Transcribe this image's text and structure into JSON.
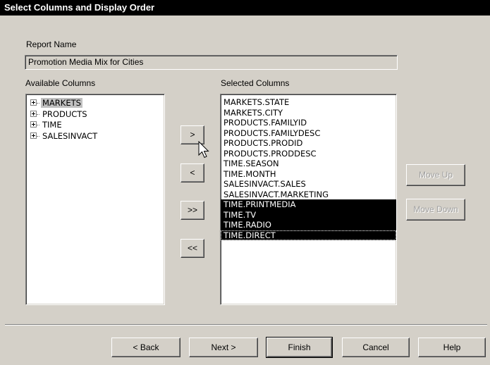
{
  "window": {
    "title": "Select Columns and Display Order"
  },
  "report_name": {
    "label": "Report Name",
    "value": "Promotion Media Mix for Cities"
  },
  "available": {
    "label": "Available Columns",
    "items": [
      {
        "label": "MARKETS",
        "selected": true
      },
      {
        "label": "PRODUCTS",
        "selected": false
      },
      {
        "label": "TIME",
        "selected": false
      },
      {
        "label": "SALESINVACT",
        "selected": false
      }
    ]
  },
  "selected": {
    "label": "Selected Columns",
    "items": [
      {
        "label": "MARKETS.STATE",
        "highlighted": false
      },
      {
        "label": "MARKETS.CITY",
        "highlighted": false
      },
      {
        "label": "PRODUCTS.FAMILYID",
        "highlighted": false
      },
      {
        "label": "PRODUCTS.FAMILYDESC",
        "highlighted": false
      },
      {
        "label": "PRODUCTS.PRODID",
        "highlighted": false
      },
      {
        "label": "PRODUCTS.PRODDESC",
        "highlighted": false
      },
      {
        "label": "TIME.SEASON",
        "highlighted": false
      },
      {
        "label": "TIME.MONTH",
        "highlighted": false
      },
      {
        "label": "SALESINVACT.SALES",
        "highlighted": false
      },
      {
        "label": "SALESINVACT.MARKETING",
        "highlighted": false
      },
      {
        "label": "TIME.PRINTMEDIA",
        "highlighted": true
      },
      {
        "label": "TIME.TV",
        "highlighted": true
      },
      {
        "label": "TIME.RADIO",
        "highlighted": true
      },
      {
        "label": "TIME.DIRECT",
        "highlighted": true
      }
    ]
  },
  "transfer": {
    "add": ">",
    "remove": "<",
    "add_all": ">>",
    "remove_all": "<<"
  },
  "order": {
    "move_up": "Move Up",
    "move_down": "Move Down"
  },
  "footer": {
    "back": "< Back",
    "next": "Next >",
    "finish": "Finish",
    "cancel": "Cancel",
    "help": "Help"
  }
}
